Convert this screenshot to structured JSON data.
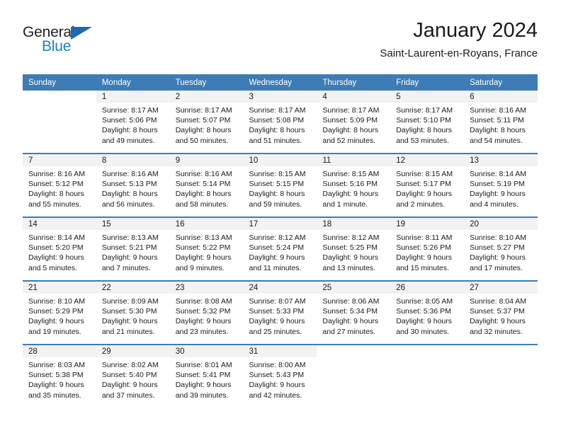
{
  "brand": {
    "name_top": "General",
    "name_bottom": "Blue",
    "triangle_color": "#1a6bb5",
    "blue_color": "#1a7fd4"
  },
  "header": {
    "title": "January 2024",
    "subtitle": "Saint-Laurent-en-Royans, France"
  },
  "theme": {
    "header_bg": "#3d7cb5",
    "daynum_bg": "#f2f2f2",
    "text": "#1a1a1a"
  },
  "calendar": {
    "weekday_headers": [
      "Sunday",
      "Monday",
      "Tuesday",
      "Wednesday",
      "Thursday",
      "Friday",
      "Saturday"
    ],
    "weeks": [
      [
        {
          "day": "",
          "sunrise": "",
          "sunset": "",
          "daylight_line1": "",
          "daylight_line2": ""
        },
        {
          "day": "1",
          "sunrise": "Sunrise: 8:17 AM",
          "sunset": "Sunset: 5:06 PM",
          "daylight_line1": "Daylight: 8 hours",
          "daylight_line2": "and 49 minutes."
        },
        {
          "day": "2",
          "sunrise": "Sunrise: 8:17 AM",
          "sunset": "Sunset: 5:07 PM",
          "daylight_line1": "Daylight: 8 hours",
          "daylight_line2": "and 50 minutes."
        },
        {
          "day": "3",
          "sunrise": "Sunrise: 8:17 AM",
          "sunset": "Sunset: 5:08 PM",
          "daylight_line1": "Daylight: 8 hours",
          "daylight_line2": "and 51 minutes."
        },
        {
          "day": "4",
          "sunrise": "Sunrise: 8:17 AM",
          "sunset": "Sunset: 5:09 PM",
          "daylight_line1": "Daylight: 8 hours",
          "daylight_line2": "and 52 minutes."
        },
        {
          "day": "5",
          "sunrise": "Sunrise: 8:17 AM",
          "sunset": "Sunset: 5:10 PM",
          "daylight_line1": "Daylight: 8 hours",
          "daylight_line2": "and 53 minutes."
        },
        {
          "day": "6",
          "sunrise": "Sunrise: 8:16 AM",
          "sunset": "Sunset: 5:11 PM",
          "daylight_line1": "Daylight: 8 hours",
          "daylight_line2": "and 54 minutes."
        }
      ],
      [
        {
          "day": "7",
          "sunrise": "Sunrise: 8:16 AM",
          "sunset": "Sunset: 5:12 PM",
          "daylight_line1": "Daylight: 8 hours",
          "daylight_line2": "and 55 minutes."
        },
        {
          "day": "8",
          "sunrise": "Sunrise: 8:16 AM",
          "sunset": "Sunset: 5:13 PM",
          "daylight_line1": "Daylight: 8 hours",
          "daylight_line2": "and 56 minutes."
        },
        {
          "day": "9",
          "sunrise": "Sunrise: 8:16 AM",
          "sunset": "Sunset: 5:14 PM",
          "daylight_line1": "Daylight: 8 hours",
          "daylight_line2": "and 58 minutes."
        },
        {
          "day": "10",
          "sunrise": "Sunrise: 8:15 AM",
          "sunset": "Sunset: 5:15 PM",
          "daylight_line1": "Daylight: 8 hours",
          "daylight_line2": "and 59 minutes."
        },
        {
          "day": "11",
          "sunrise": "Sunrise: 8:15 AM",
          "sunset": "Sunset: 5:16 PM",
          "daylight_line1": "Daylight: 9 hours",
          "daylight_line2": "and 1 minute."
        },
        {
          "day": "12",
          "sunrise": "Sunrise: 8:15 AM",
          "sunset": "Sunset: 5:17 PM",
          "daylight_line1": "Daylight: 9 hours",
          "daylight_line2": "and 2 minutes."
        },
        {
          "day": "13",
          "sunrise": "Sunrise: 8:14 AM",
          "sunset": "Sunset: 5:19 PM",
          "daylight_line1": "Daylight: 9 hours",
          "daylight_line2": "and 4 minutes."
        }
      ],
      [
        {
          "day": "14",
          "sunrise": "Sunrise: 8:14 AM",
          "sunset": "Sunset: 5:20 PM",
          "daylight_line1": "Daylight: 9 hours",
          "daylight_line2": "and 5 minutes."
        },
        {
          "day": "15",
          "sunrise": "Sunrise: 8:13 AM",
          "sunset": "Sunset: 5:21 PM",
          "daylight_line1": "Daylight: 9 hours",
          "daylight_line2": "and 7 minutes."
        },
        {
          "day": "16",
          "sunrise": "Sunrise: 8:13 AM",
          "sunset": "Sunset: 5:22 PM",
          "daylight_line1": "Daylight: 9 hours",
          "daylight_line2": "and 9 minutes."
        },
        {
          "day": "17",
          "sunrise": "Sunrise: 8:12 AM",
          "sunset": "Sunset: 5:24 PM",
          "daylight_line1": "Daylight: 9 hours",
          "daylight_line2": "and 11 minutes."
        },
        {
          "day": "18",
          "sunrise": "Sunrise: 8:12 AM",
          "sunset": "Sunset: 5:25 PM",
          "daylight_line1": "Daylight: 9 hours",
          "daylight_line2": "and 13 minutes."
        },
        {
          "day": "19",
          "sunrise": "Sunrise: 8:11 AM",
          "sunset": "Sunset: 5:26 PM",
          "daylight_line1": "Daylight: 9 hours",
          "daylight_line2": "and 15 minutes."
        },
        {
          "day": "20",
          "sunrise": "Sunrise: 8:10 AM",
          "sunset": "Sunset: 5:27 PM",
          "daylight_line1": "Daylight: 9 hours",
          "daylight_line2": "and 17 minutes."
        }
      ],
      [
        {
          "day": "21",
          "sunrise": "Sunrise: 8:10 AM",
          "sunset": "Sunset: 5:29 PM",
          "daylight_line1": "Daylight: 9 hours",
          "daylight_line2": "and 19 minutes."
        },
        {
          "day": "22",
          "sunrise": "Sunrise: 8:09 AM",
          "sunset": "Sunset: 5:30 PM",
          "daylight_line1": "Daylight: 9 hours",
          "daylight_line2": "and 21 minutes."
        },
        {
          "day": "23",
          "sunrise": "Sunrise: 8:08 AM",
          "sunset": "Sunset: 5:32 PM",
          "daylight_line1": "Daylight: 9 hours",
          "daylight_line2": "and 23 minutes."
        },
        {
          "day": "24",
          "sunrise": "Sunrise: 8:07 AM",
          "sunset": "Sunset: 5:33 PM",
          "daylight_line1": "Daylight: 9 hours",
          "daylight_line2": "and 25 minutes."
        },
        {
          "day": "25",
          "sunrise": "Sunrise: 8:06 AM",
          "sunset": "Sunset: 5:34 PM",
          "daylight_line1": "Daylight: 9 hours",
          "daylight_line2": "and 27 minutes."
        },
        {
          "day": "26",
          "sunrise": "Sunrise: 8:05 AM",
          "sunset": "Sunset: 5:36 PM",
          "daylight_line1": "Daylight: 9 hours",
          "daylight_line2": "and 30 minutes."
        },
        {
          "day": "27",
          "sunrise": "Sunrise: 8:04 AM",
          "sunset": "Sunset: 5:37 PM",
          "daylight_line1": "Daylight: 9 hours",
          "daylight_line2": "and 32 minutes."
        }
      ],
      [
        {
          "day": "28",
          "sunrise": "Sunrise: 8:03 AM",
          "sunset": "Sunset: 5:38 PM",
          "daylight_line1": "Daylight: 9 hours",
          "daylight_line2": "and 35 minutes."
        },
        {
          "day": "29",
          "sunrise": "Sunrise: 8:02 AM",
          "sunset": "Sunset: 5:40 PM",
          "daylight_line1": "Daylight: 9 hours",
          "daylight_line2": "and 37 minutes."
        },
        {
          "day": "30",
          "sunrise": "Sunrise: 8:01 AM",
          "sunset": "Sunset: 5:41 PM",
          "daylight_line1": "Daylight: 9 hours",
          "daylight_line2": "and 39 minutes."
        },
        {
          "day": "31",
          "sunrise": "Sunrise: 8:00 AM",
          "sunset": "Sunset: 5:43 PM",
          "daylight_line1": "Daylight: 9 hours",
          "daylight_line2": "and 42 minutes."
        },
        {
          "day": "",
          "sunrise": "",
          "sunset": "",
          "daylight_line1": "",
          "daylight_line2": ""
        },
        {
          "day": "",
          "sunrise": "",
          "sunset": "",
          "daylight_line1": "",
          "daylight_line2": ""
        },
        {
          "day": "",
          "sunrise": "",
          "sunset": "",
          "daylight_line1": "",
          "daylight_line2": ""
        }
      ]
    ]
  }
}
